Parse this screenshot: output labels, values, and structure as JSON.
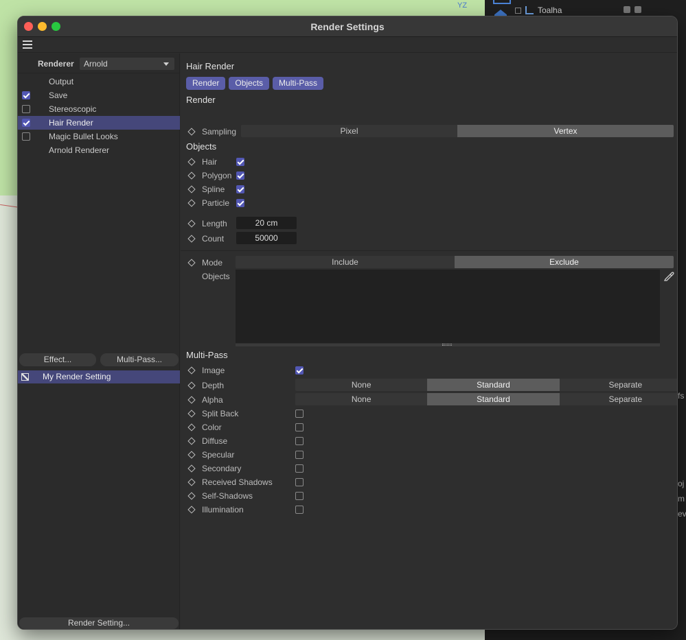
{
  "background": {
    "axis_label": "YZ",
    "object_name": "Toalha",
    "side_texts": [
      "fs",
      "oj",
      "m",
      "ev"
    ]
  },
  "window": {
    "title": "Render Settings"
  },
  "left": {
    "renderer_label": "Renderer",
    "renderer_value": "Arnold",
    "items": [
      {
        "label": "Output",
        "checkbox": "none"
      },
      {
        "label": "Save",
        "checkbox": "on"
      },
      {
        "label": "Stereoscopic",
        "checkbox": "off"
      },
      {
        "label": "Hair Render",
        "checkbox": "on",
        "selected": true
      },
      {
        "label": "Magic Bullet Looks",
        "checkbox": "off"
      },
      {
        "label": "Arnold Renderer",
        "checkbox": "none"
      }
    ],
    "effect_button": "Effect...",
    "multipass_button": "Multi-Pass...",
    "setting_name": "My Render Setting",
    "render_setting_button": "Render Setting..."
  },
  "right": {
    "heading": "Hair Render",
    "tabs": [
      "Render",
      "Objects",
      "Multi-Pass"
    ],
    "render_title": "Render",
    "sampling": {
      "label": "Sampling",
      "options": [
        "Pixel",
        "Vertex"
      ],
      "selected": "Vertex"
    },
    "objects_title": "Objects",
    "object_toggles": [
      {
        "label": "Hair",
        "checked": true
      },
      {
        "label": "Polygon",
        "checked": true
      },
      {
        "label": "Spline",
        "checked": true
      },
      {
        "label": "Particle",
        "checked": true
      }
    ],
    "length": {
      "label": "Length",
      "value": "20 cm"
    },
    "count": {
      "label": "Count",
      "value": "50000"
    },
    "mode": {
      "label": "Mode",
      "options": [
        "Include",
        "Exclude"
      ],
      "selected": "Exclude"
    },
    "objects_list_label": "Objects",
    "multipass_title": "Multi-Pass",
    "image": {
      "label": "Image",
      "checked": true
    },
    "depth": {
      "label": "Depth",
      "options": [
        "None",
        "Standard",
        "Separate"
      ],
      "selected": "Standard"
    },
    "alpha": {
      "label": "Alpha",
      "options": [
        "None",
        "Standard",
        "Separate"
      ],
      "selected": "Standard"
    },
    "passes": [
      {
        "label": "Split Back",
        "checked": false
      },
      {
        "label": "Color",
        "checked": false
      },
      {
        "label": "Diffuse",
        "checked": false
      },
      {
        "label": "Specular",
        "checked": false
      },
      {
        "label": "Secondary",
        "checked": false
      },
      {
        "label": "Received Shadows",
        "checked": false
      },
      {
        "label": "Self-Shadows",
        "checked": false
      },
      {
        "label": "Illumination",
        "checked": false
      }
    ]
  },
  "colors": {
    "accent": "#5a5da8",
    "selection": "#45477a",
    "checkbox_on": "#5257b3"
  }
}
